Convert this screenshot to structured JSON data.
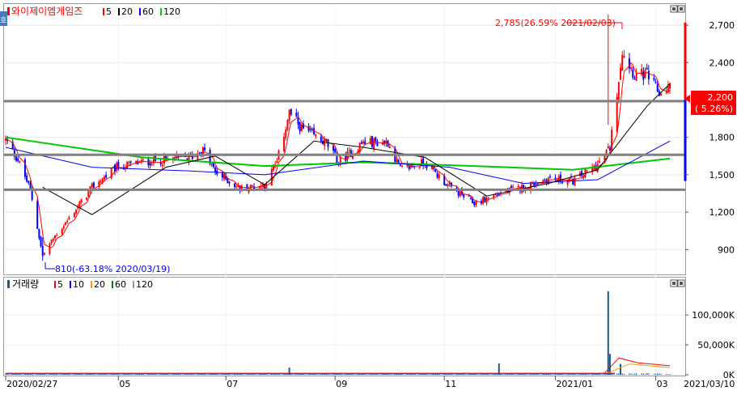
{
  "price_panel": {
    "title": "와이제이엠게임즈",
    "legend": [
      {
        "label": "5",
        "color": "#ff0000"
      },
      {
        "label": "20",
        "color": "#000000"
      },
      {
        "label": "60",
        "color": "#0000ff"
      },
      {
        "label": "120",
        "color": "#00c800"
      }
    ],
    "high_annotation": "2,785(26.59% 2021/02/03)",
    "low_annotation": "810(-63.18% 2020/03/19)",
    "current_price": "2,200",
    "current_change": "( 5.26%)",
    "corner_icon_glyph": "호"
  },
  "volume_panel": {
    "title": "거래량",
    "legend": [
      {
        "label": "5",
        "color": "#ff0000"
      },
      {
        "label": "10",
        "color": "#0000ff"
      },
      {
        "label": "20",
        "color": "#ff9900"
      },
      {
        "label": "60",
        "color": "#008000"
      },
      {
        "label": "120",
        "color": "#999999"
      }
    ]
  },
  "colors": {
    "up": "#ff0000",
    "down": "#0000ff",
    "ma5": "#ff0000",
    "ma20": "#000000",
    "ma60": "#0000ff",
    "ma120": "#00c800",
    "support": "#808080",
    "volume": "#1a5a8a"
  },
  "chart_data": {
    "type": "candlestick",
    "date_start": "2020/02/27",
    "date_end": "2021/03/10",
    "x_tick_labels": [
      "2020/02/27",
      "05",
      "07",
      "09",
      "11",
      "2021/01",
      "03",
      "2021/03/10"
    ],
    "price_axis": {
      "ticks": [
        900,
        1200,
        1500,
        1800,
        2100,
        2400,
        2700
      ],
      "tick_labels": [
        "900",
        "1,200",
        "1,500",
        "1,800",
        "2,100",
        "2,400",
        "2,700"
      ],
      "range": [
        720,
        2850
      ]
    },
    "volume_axis": {
      "ticks": [
        0,
        50000,
        100000
      ],
      "tick_labels": [
        "0K",
        "50,000K",
        "100,000K"
      ],
      "range": [
        0,
        145000
      ]
    },
    "horizontal_levels": [
      2090,
      1660,
      1380
    ],
    "price_path": [
      {
        "date": "2020-02-27",
        "price": 1780
      },
      {
        "date": "2020-03-05",
        "price": 1620
      },
      {
        "date": "2020-03-12",
        "price": 1380
      },
      {
        "date": "2020-03-19",
        "price": 850
      },
      {
        "date": "2020-03-26",
        "price": 1010
      },
      {
        "date": "2020-04-02",
        "price": 1130
      },
      {
        "date": "2020-04-16",
        "price": 1400
      },
      {
        "date": "2020-04-30",
        "price": 1560
      },
      {
        "date": "2020-05-14",
        "price": 1600
      },
      {
        "date": "2020-05-28",
        "price": 1620
      },
      {
        "date": "2020-06-11",
        "price": 1640
      },
      {
        "date": "2020-06-18",
        "price": 1700
      },
      {
        "date": "2020-06-25",
        "price": 1520
      },
      {
        "date": "2020-07-09",
        "price": 1390
      },
      {
        "date": "2020-07-23",
        "price": 1420
      },
      {
        "date": "2020-07-30",
        "price": 1600
      },
      {
        "date": "2020-08-06",
        "price": 2000
      },
      {
        "date": "2020-08-13",
        "price": 1870
      },
      {
        "date": "2020-08-27",
        "price": 1750
      },
      {
        "date": "2020-09-03",
        "price": 1600
      },
      {
        "date": "2020-09-17",
        "price": 1760
      },
      {
        "date": "2020-10-01",
        "price": 1760
      },
      {
        "date": "2020-10-08",
        "price": 1540
      },
      {
        "date": "2020-10-22",
        "price": 1600
      },
      {
        "date": "2020-11-05",
        "price": 1400
      },
      {
        "date": "2020-11-19",
        "price": 1270
      },
      {
        "date": "2020-12-03",
        "price": 1350
      },
      {
        "date": "2020-12-17",
        "price": 1400
      },
      {
        "date": "2020-12-31",
        "price": 1470
      },
      {
        "date": "2021-01-14",
        "price": 1450
      },
      {
        "date": "2021-01-28",
        "price": 1580
      },
      {
        "date": "2021-02-04",
        "price": 1720
      },
      {
        "date": "2021-02-11",
        "price": 2500
      },
      {
        "date": "2021-02-18",
        "price": 2300
      },
      {
        "date": "2021-02-25",
        "price": 2300
      },
      {
        "date": "2021-03-04",
        "price": 2150
      },
      {
        "date": "2021-03-10",
        "price": 2200
      }
    ],
    "price_high": {
      "date": "2021-02-03",
      "price": 2785
    },
    "price_low": {
      "date": "2020-03-19",
      "price": 810
    },
    "moving_averages": {
      "ma20": [
        {
          "date": "2020-03-19",
          "price": 1400
        },
        {
          "date": "2020-04-16",
          "price": 1180
        },
        {
          "date": "2020-05-28",
          "price": 1560
        },
        {
          "date": "2020-06-25",
          "price": 1650
        },
        {
          "date": "2020-07-23",
          "price": 1420
        },
        {
          "date": "2020-08-20",
          "price": 1770
        },
        {
          "date": "2020-09-17",
          "price": 1720
        },
        {
          "date": "2020-10-22",
          "price": 1640
        },
        {
          "date": "2020-11-26",
          "price": 1330
        },
        {
          "date": "2020-12-31",
          "price": 1430
        },
        {
          "date": "2021-01-28",
          "price": 1540
        },
        {
          "date": "2021-02-25",
          "price": 2050
        },
        {
          "date": "2021-03-10",
          "price": 2230
        }
      ],
      "ma60": [
        {
          "date": "2020-02-27",
          "price": 1720
        },
        {
          "date": "2020-04-16",
          "price": 1560
        },
        {
          "date": "2020-06-11",
          "price": 1530
        },
        {
          "date": "2020-07-23",
          "price": 1500
        },
        {
          "date": "2020-09-17",
          "price": 1610
        },
        {
          "date": "2020-11-05",
          "price": 1560
        },
        {
          "date": "2020-12-17",
          "price": 1430
        },
        {
          "date": "2021-01-28",
          "price": 1460
        },
        {
          "date": "2021-03-10",
          "price": 1770
        }
      ],
      "ma120": [
        {
          "date": "2020-02-27",
          "price": 1800
        },
        {
          "date": "2020-05-14",
          "price": 1640
        },
        {
          "date": "2020-07-23",
          "price": 1570
        },
        {
          "date": "2020-09-17",
          "price": 1600
        },
        {
          "date": "2020-11-19",
          "price": 1570
        },
        {
          "date": "2021-01-14",
          "price": 1540
        },
        {
          "date": "2021-03-10",
          "price": 1630
        }
      ]
    },
    "volume_spikes": [
      {
        "date": "2020-08-06",
        "volume": 12000
      },
      {
        "date": "2020-12-03",
        "volume": 19000
      },
      {
        "date": "2021-02-03",
        "volume": 140000
      },
      {
        "date": "2021-02-04",
        "volume": 35000
      },
      {
        "date": "2021-02-10",
        "volume": 18000
      }
    ]
  }
}
